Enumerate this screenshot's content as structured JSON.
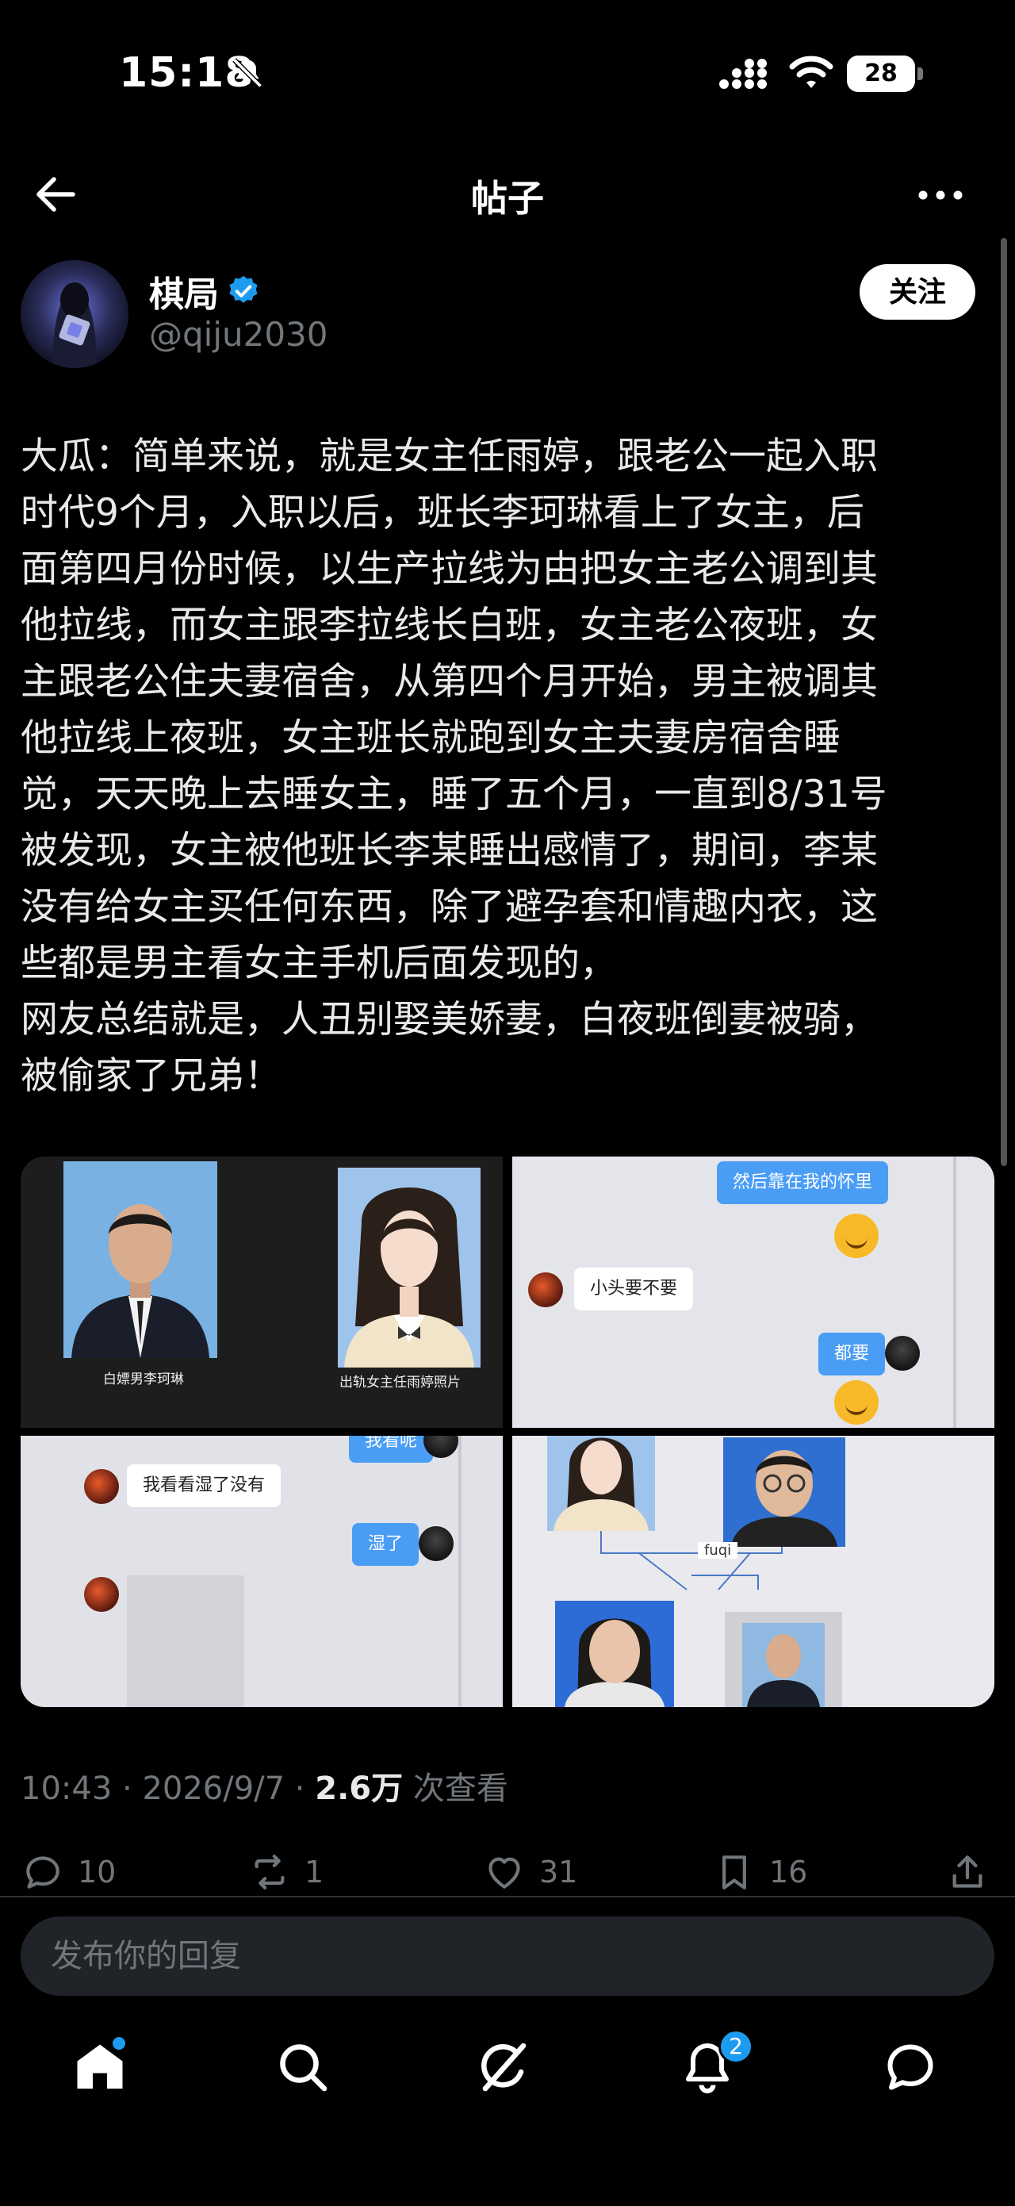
{
  "status_bar": {
    "time": "15:18",
    "battery": "28",
    "icons": [
      "bell-off-icon",
      "cellular-signal-icon",
      "wifi-icon",
      "battery-icon"
    ]
  },
  "nav": {
    "title": "帖子",
    "back_icon": "arrow-left-icon",
    "more_icon": "more-horizontal-icon"
  },
  "author": {
    "name": "棋局",
    "handle": "@qiju2030",
    "verified": true,
    "follow_label": "关注"
  },
  "post": {
    "text": "大瓜：简单来说，就是女主任雨婷，跟老公一起入职\n时代9个月，入职以后，班长李珂琳看上了女主，后\n面第四月份时候，以生产拉线为由把女主老公调到其\n他拉线，而女主跟李拉线长白班，女主老公夜班，女\n主跟老公住夫妻宿舍，从第四个月开始，男主被调其\n他拉线上夜班，女主班长就跑到女主夫妻房宿舍睡\n觉，天天晚上去睡女主，睡了五个月，一直到8/31号\n被发现，女主被他班长李某睡出感情了，期间，李某\n没有给女主买任何东西，除了避孕套和情趣内衣，这\n些都是男主看女主手机后面发现的，\n网友总结就是，人丑别娶美娇妻，白夜班倒妻被骑，\n被偷家了兄弟！"
  },
  "media": {
    "cell1": {
      "left_caption": "白嫖男李珂琳",
      "right_caption": "出轨女主任雨婷照片"
    },
    "cell2": {
      "bubble_top": "然后靠在我的怀里",
      "bubble_left": "小头要不要",
      "bubble_right": "都要"
    },
    "cell3": {
      "bubble_top": "我看呢",
      "bubble_left": "我看看湿了没有",
      "bubble_right": "湿了"
    },
    "cell4": {
      "label": "fuqi"
    }
  },
  "meta": {
    "time": "10:43",
    "sep1": " · ",
    "date": "2026/9/7",
    "sep2": " · ",
    "views": "2.6万",
    "views_label": " 次查看"
  },
  "actions": {
    "replies": "10",
    "reposts": "1",
    "likes": "31",
    "bookmarks": "16"
  },
  "reply": {
    "placeholder": "发布你的回复"
  },
  "tabbar": {
    "notifications_badge": "2",
    "items": [
      "home-icon",
      "search-icon",
      "grok-icon",
      "notifications-icon",
      "messages-icon"
    ]
  },
  "colors": {
    "accent": "#1d9bf0",
    "background": "#000000",
    "secondary_text": "#71767b"
  }
}
